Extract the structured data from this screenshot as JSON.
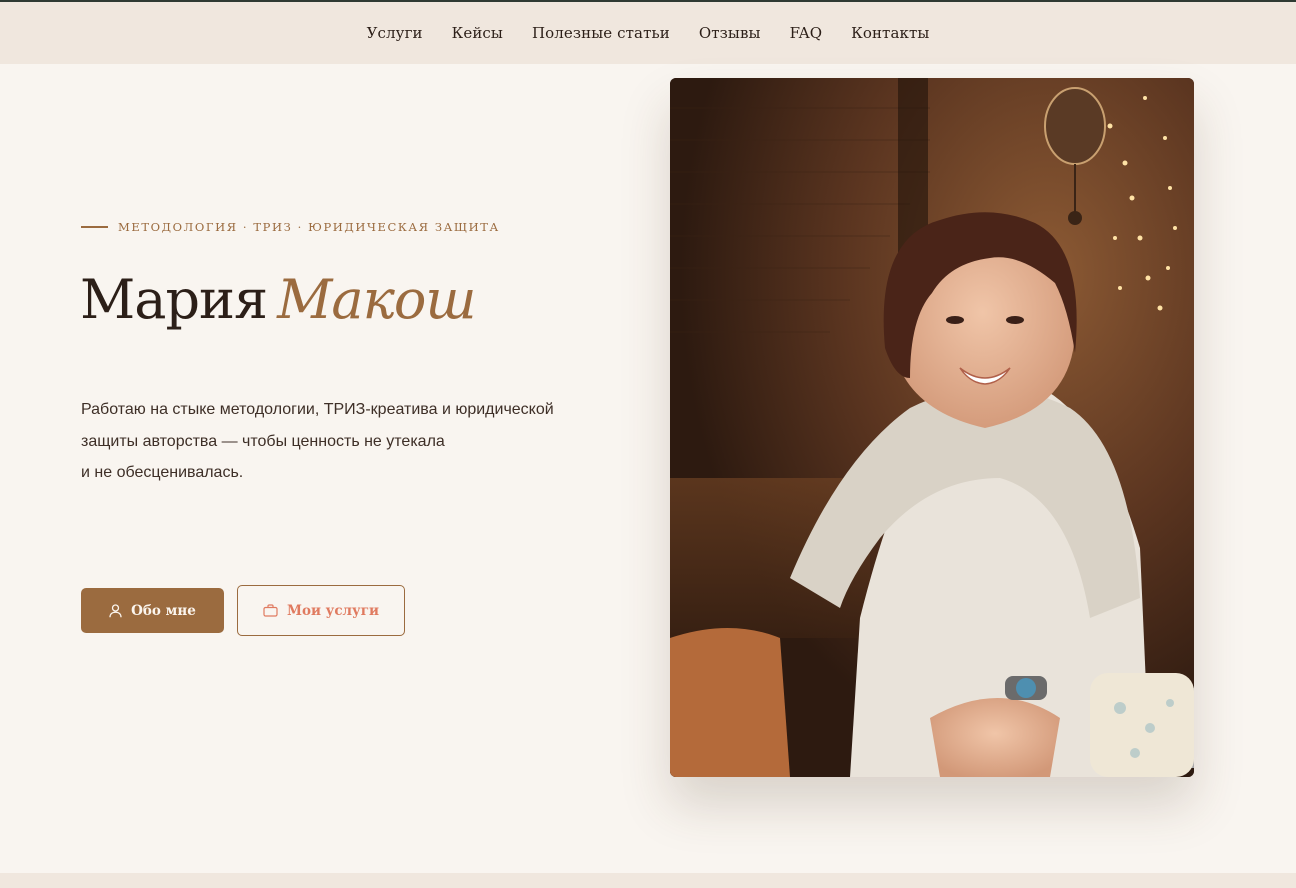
{
  "nav": {
    "items": [
      "Услуги",
      "Кейсы",
      "Полезные статьи",
      "Отзывы",
      "FAQ",
      "Контакты"
    ]
  },
  "hero": {
    "eyebrow": "Методология · ТРИЗ · юридическая защита",
    "first_name": "Мария",
    "last_name": "Макош",
    "lead_lines": [
      "Работаю на стыке методологии, ТРИЗ-креатива и юридической",
      "защиты авторства — чтобы ценность не утекала",
      "и не обесценивалась."
    ],
    "buttons": {
      "about": {
        "label": "Обо мне",
        "icon": "user-icon"
      },
      "services": {
        "label": "Мои услуги",
        "icon": "briefcase-icon"
      }
    }
  },
  "colors": {
    "accent": "#9b6b3f",
    "coral": "#e07a5f",
    "background": "#f9f5f0",
    "nav_background": "#f0e7de",
    "text": "#2c1f18"
  }
}
